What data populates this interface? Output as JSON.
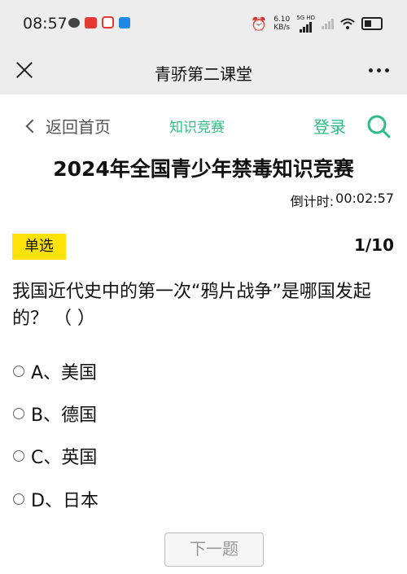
{
  "status_bar": {
    "time": "08:57",
    "net_speed": "6.10",
    "net_unit": "KB/s",
    "network_badge": "5G HD"
  },
  "app_bar": {
    "title": "青骄第二课堂"
  },
  "nav": {
    "back_label": "返回首页",
    "center_label": "知识竞赛",
    "login_label": "登录"
  },
  "contest": {
    "title": "2024年全国青少年禁毒知识竞赛",
    "countdown_label": "倒计时:",
    "countdown_value": "00:02:57"
  },
  "question": {
    "type_label": "单选",
    "progress": "1/10",
    "text": "我国近代史中的第一次“鸦片战争”是哪国发起的？ （ ）",
    "options": [
      {
        "label": "A、美国"
      },
      {
        "label": "B、德国"
      },
      {
        "label": "C、英国"
      },
      {
        "label": "D、日本"
      }
    ]
  },
  "next_button": "下一题",
  "colors": {
    "accent_green": "#2ebc83",
    "badge_yellow": "#ffe30a",
    "header_gray": "#ededed"
  }
}
